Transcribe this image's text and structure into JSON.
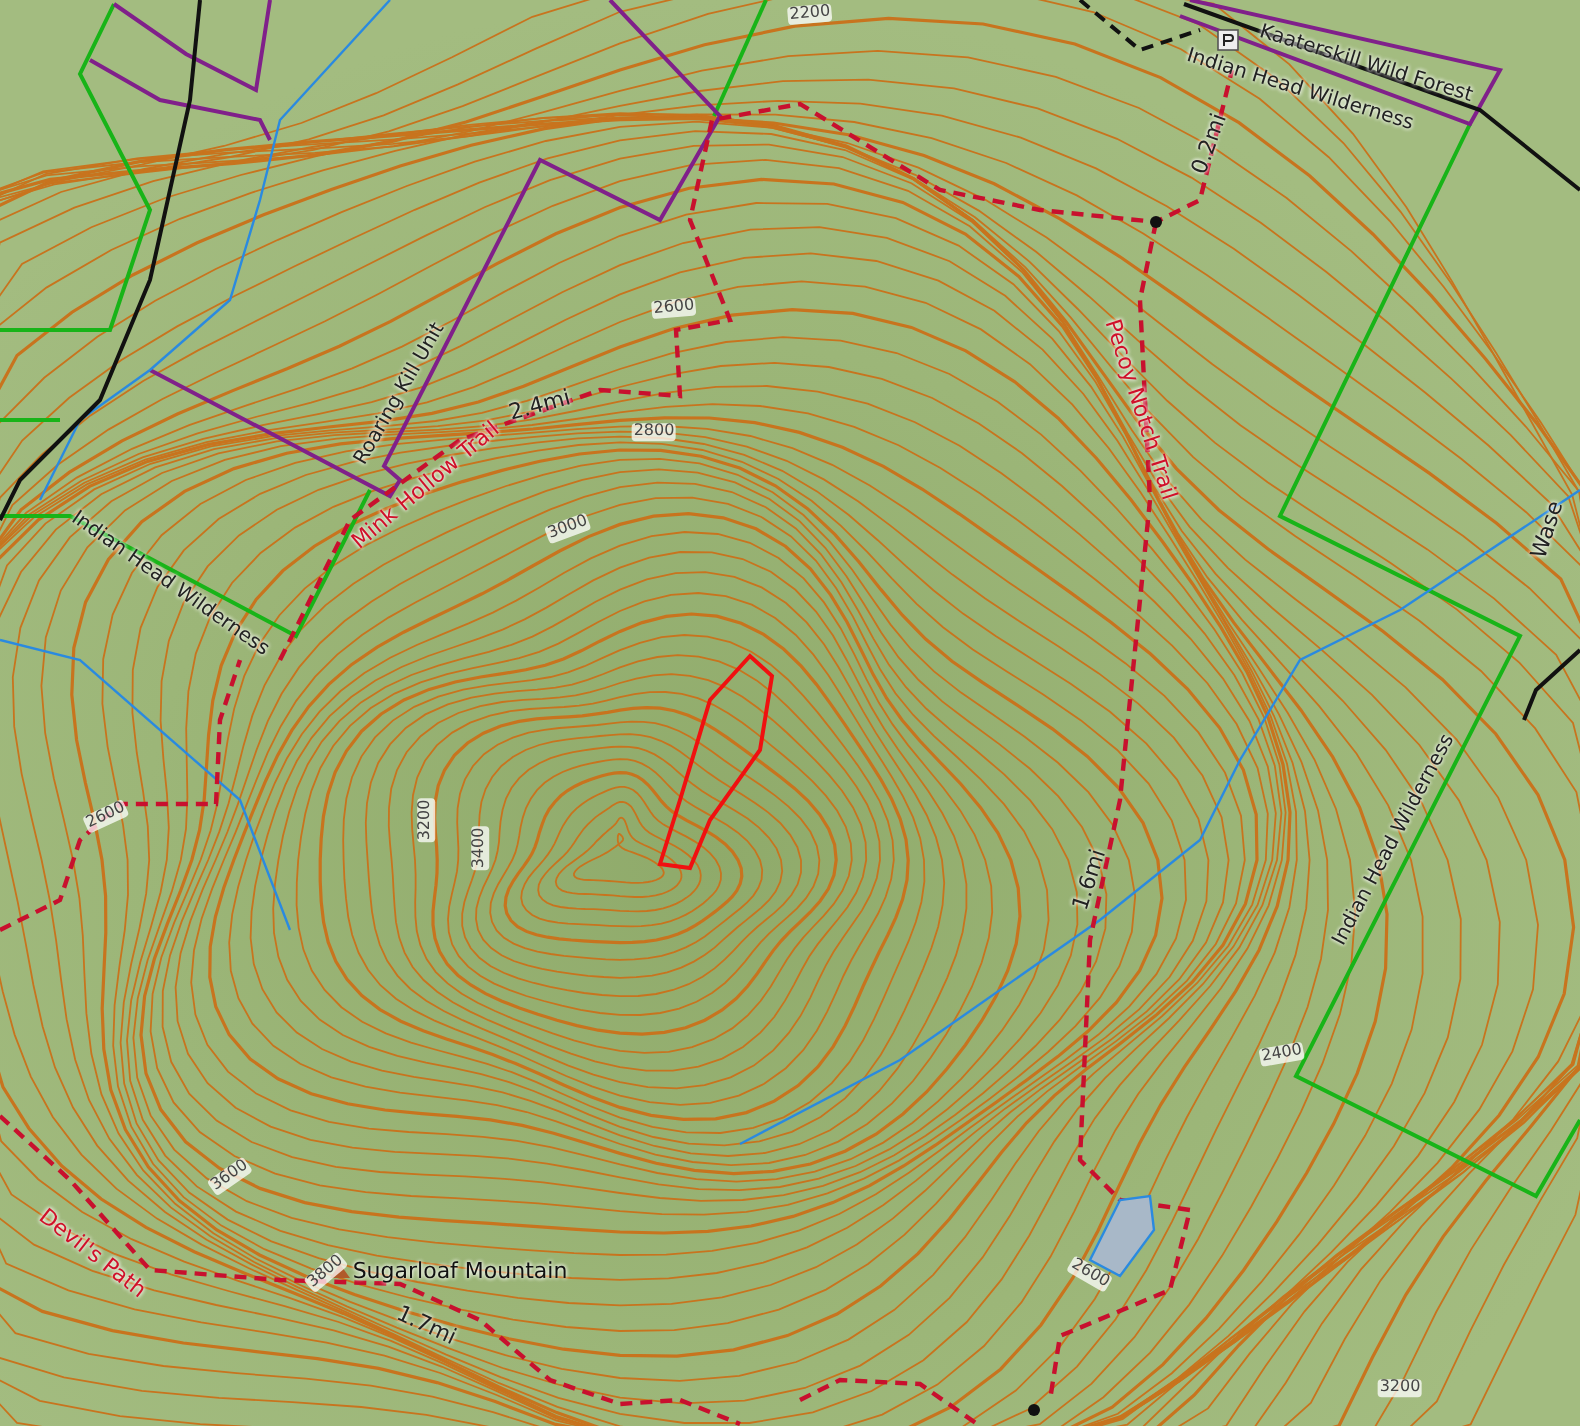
{
  "map": {
    "labels": [
      {
        "text": "2200",
        "kind": "contour"
      },
      {
        "text": "Kaaterskill Wild Forest",
        "kind": "area"
      },
      {
        "text": "Indian Head Wilderness",
        "kind": "area"
      },
      {
        "text": "0.2mi",
        "kind": "distance"
      },
      {
        "text": "2600",
        "kind": "contour"
      },
      {
        "text": "Roaring Kill Unit",
        "kind": "area"
      },
      {
        "text": "Mink Hollow Trail",
        "kind": "trail"
      },
      {
        "text": "2.4mi",
        "kind": "distance"
      },
      {
        "text": "2800",
        "kind": "contour"
      },
      {
        "text": "3000",
        "kind": "contour"
      },
      {
        "text": "Indian Head Wilderness",
        "kind": "area"
      },
      {
        "text": "Pecoy Notch Trail",
        "kind": "trail"
      },
      {
        "text": "Wase",
        "kind": "road"
      },
      {
        "text": "2600",
        "kind": "contour"
      },
      {
        "text": "3200",
        "kind": "contour"
      },
      {
        "text": "3400",
        "kind": "contour"
      },
      {
        "text": "1.6mi",
        "kind": "distance"
      },
      {
        "text": "Indian Head Wilderness",
        "kind": "area"
      },
      {
        "text": "2400",
        "kind": "contour"
      },
      {
        "text": "3600",
        "kind": "contour"
      },
      {
        "text": "Devil's Path",
        "kind": "trail"
      },
      {
        "text": "3800",
        "kind": "contour"
      },
      {
        "text": "Sugarloaf Mountain",
        "kind": "peak"
      },
      {
        "text": "1.7mi",
        "kind": "distance"
      },
      {
        "text": "2600",
        "kind": "contour"
      },
      {
        "text": "3200",
        "kind": "contour"
      }
    ]
  }
}
